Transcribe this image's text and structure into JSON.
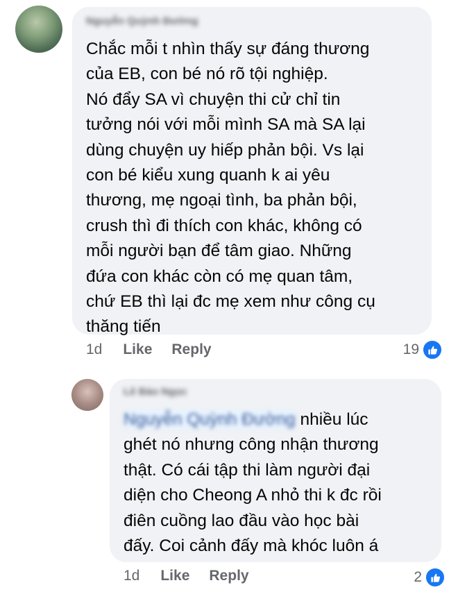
{
  "comments": [
    {
      "author": "Nguyễn Quỳnh Đường",
      "text": "Chắc mỗi  t nhìn thấy sự đáng thương\ncủa EB, con bé nó rõ tội nghiệp.\nNó đẩy SA vì chuyện thi cử chỉ tin\ntưởng nói với mỗi mình SA mà SA lại\ndùng chuyện uy hiếp phản bội. Vs lại\ncon bé kiểu xung quanh k ai yêu\nthương, mẹ ngoại tình, ba phản bội,\ncrush thì đi thích con khác, không có\nmỗi người bạn để tâm giao. Những\nđứa con khác còn có mẹ quan tâm,\nchứ EB thì lại đc mẹ xem như công cụ\nthăng tiến",
      "time": "1d",
      "like_label": "Like",
      "reply_label": "Reply",
      "reaction_count": "19",
      "reaction_icon": "like-icon"
    },
    {
      "author": "Lê Bảo Ngọc",
      "mention": "Nguyễn Quỳnh Đường",
      "text_first_line": " nhiều lúc",
      "text_rest": "ghét nó nhưng công nhận thương\nthật. Có cái tập thi làm người đại\ndiện cho Cheong A nhỏ thi k đc rồi\nđiên cuồng lao đầu vào học bài\nđấy. Coi cảnh đấy mà khóc luôn á",
      "time": "1d",
      "like_label": "Like",
      "reply_label": "Reply",
      "reaction_count": "2",
      "reaction_icon": "like-icon"
    }
  ],
  "colors": {
    "bubble": "#f0f2f5",
    "text": "#050505",
    "meta": "#65676b",
    "like_blue": "#1877f2"
  }
}
